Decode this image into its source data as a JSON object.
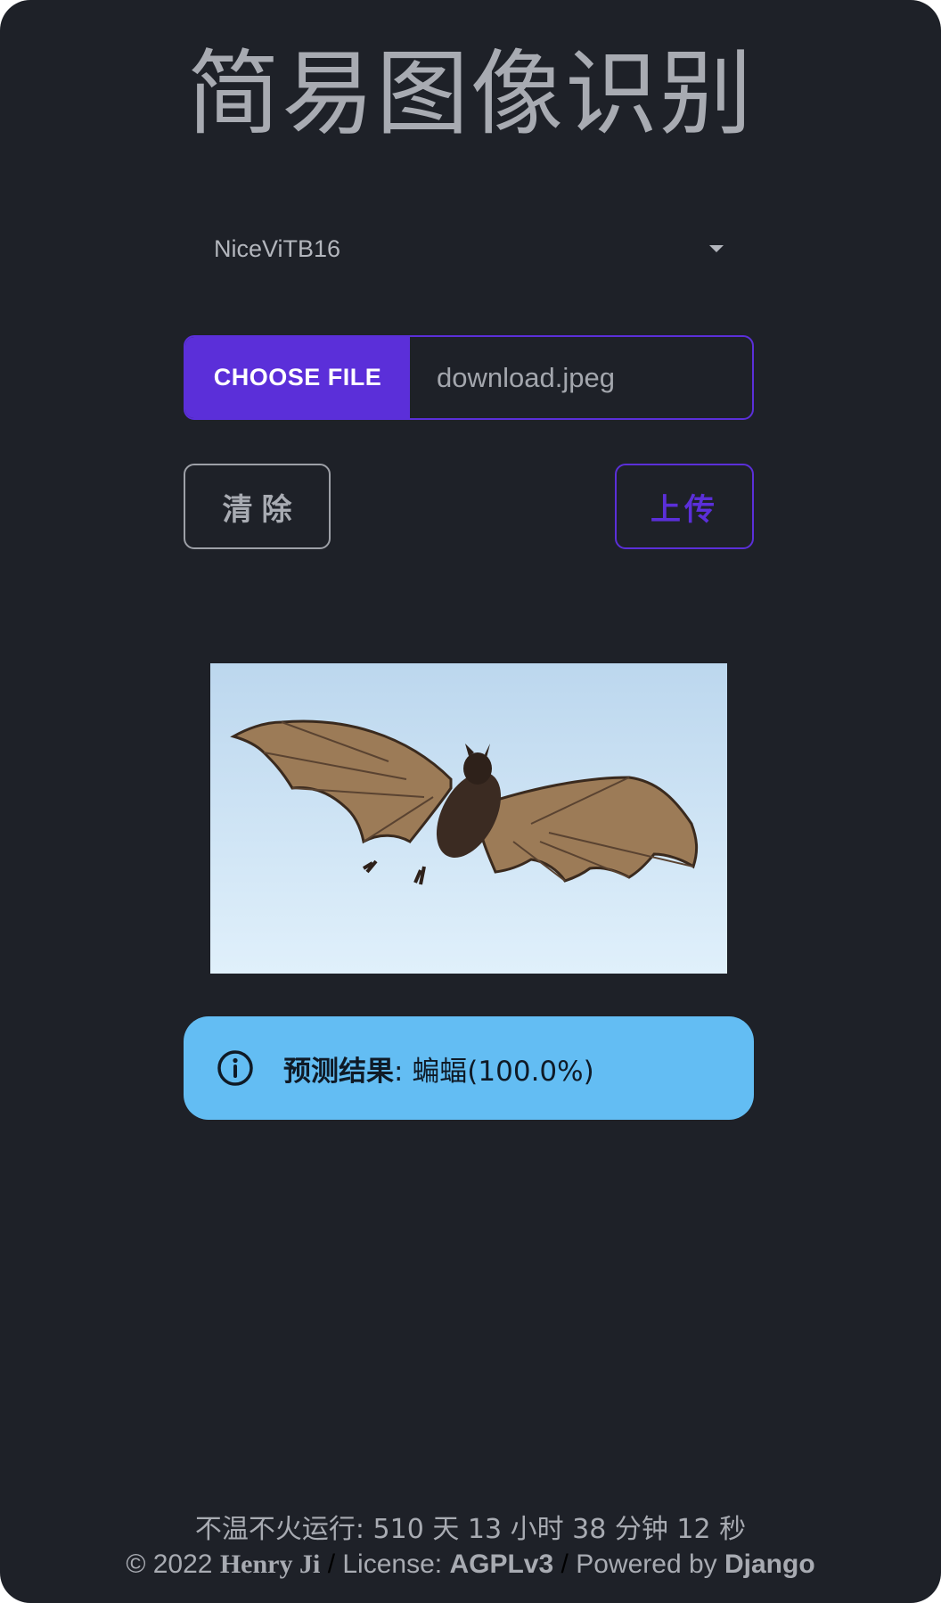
{
  "page": {
    "title": "简易图像识别"
  },
  "model_select": {
    "value": "NiceViTB16"
  },
  "file_input": {
    "button_label": "CHOOSE FILE",
    "file_name": "download.jpeg"
  },
  "actions": {
    "clear_label": "清除",
    "upload_label": "上传"
  },
  "preview": {
    "subject": "bat"
  },
  "result": {
    "prefix": "预测结果",
    "separator": ":",
    "value": "蝙蝠(100.0%)"
  },
  "footer": {
    "uptime": "不温不火运行: 510 天 13 小时 38 分钟 12 秒",
    "copyright": "© 2022",
    "author": "Henry Ji",
    "sep1": "/",
    "license_label": "License:",
    "license": "AGPLv3",
    "sep2": "/",
    "powered_label": "Powered by",
    "powered": "Django"
  },
  "colors": {
    "background": "#1e2128",
    "accent": "#5b2fd9",
    "info": "#63bdf3",
    "text": "#a8abb2"
  }
}
